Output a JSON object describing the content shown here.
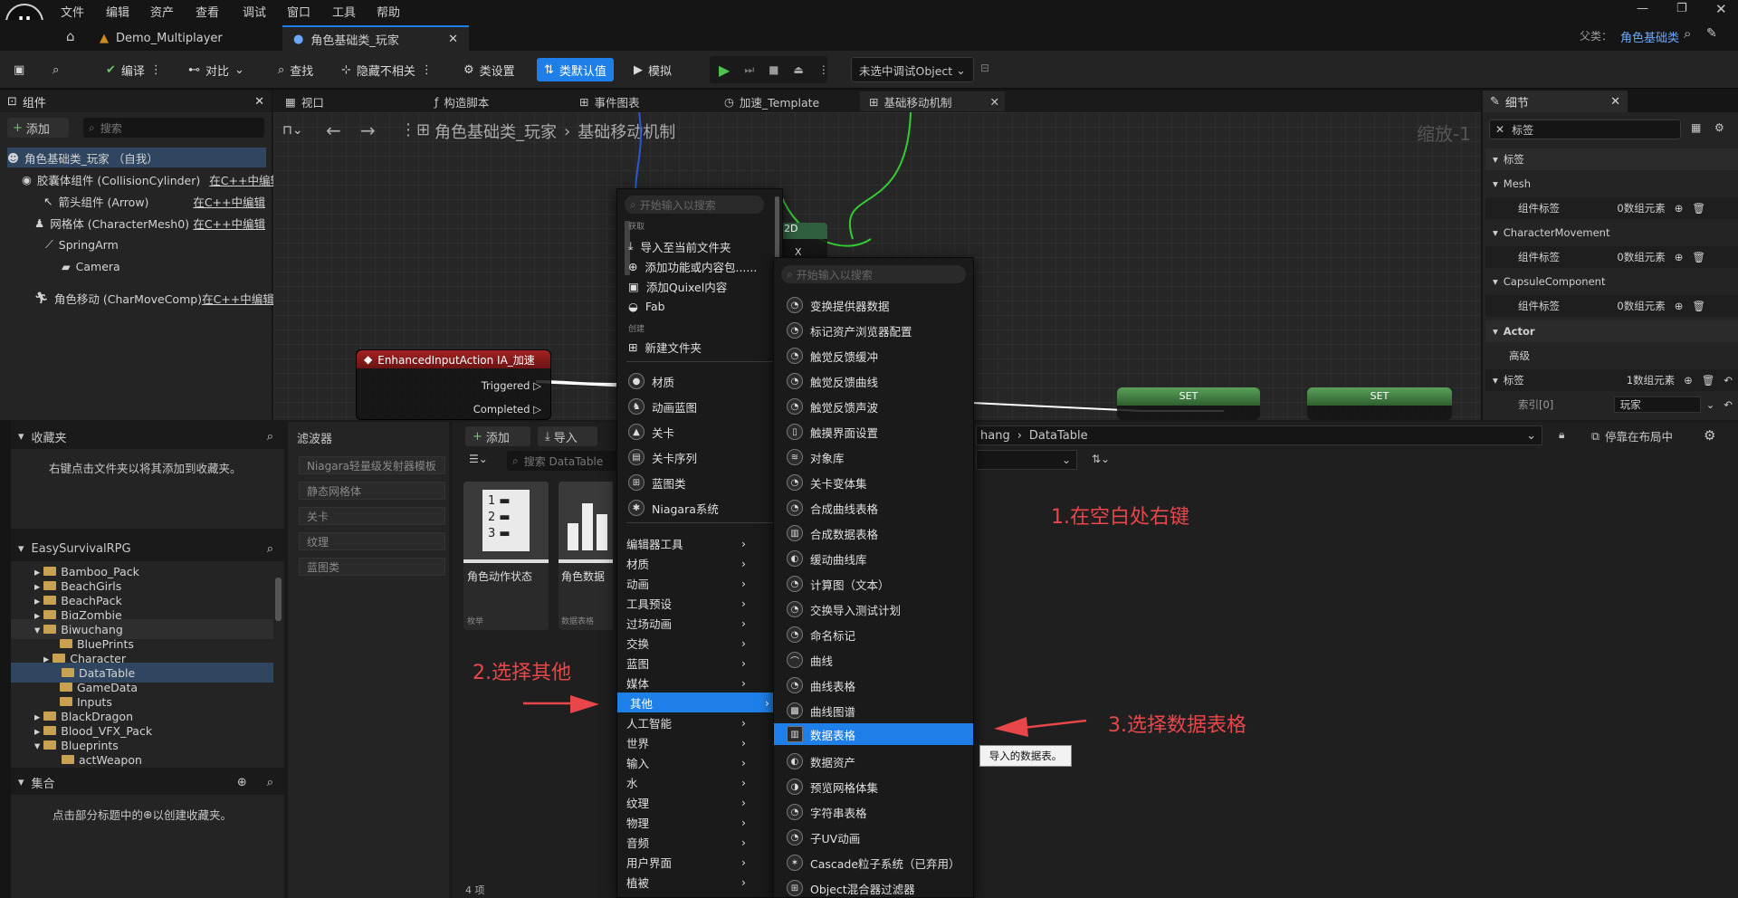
{
  "menubar": {
    "items": [
      "文件",
      "编辑",
      "资产",
      "查看",
      "调试",
      "窗口",
      "工具",
      "帮助"
    ]
  },
  "tabs": {
    "project": "Demo_Multiplayer",
    "active": "角色基础类_玩家"
  },
  "parent": {
    "label": "父类：",
    "value": "角色基础类"
  },
  "toolbar": {
    "compile": "编译",
    "diff": "对比",
    "find": "查找",
    "hide_unrelated": "隐藏不相关",
    "class_settings": "类设置",
    "class_defaults": "类默认值",
    "simulate": "模拟",
    "debug_object": "未选中调试Object"
  },
  "components": {
    "title": "组件",
    "add": "添加",
    "search_placeholder": "搜索",
    "root": "角色基础类_玩家 （自我）",
    "edit_cpp": "在C++中编辑",
    "items": [
      "胶囊体组件 (CollisionCylinder)",
      "箭头组件 (Arrow)",
      "网格体 (CharacterMesh0)",
      "SpringArm",
      "Camera",
      "角色移动 (CharMoveComp)"
    ]
  },
  "graph_tabs": [
    "视口",
    "构造脚本",
    "事件图表",
    "加速_Template",
    "基础移动机制"
  ],
  "breadcrumb": {
    "root": "角色基础类_玩家",
    "current": "基础移动机制",
    "zoom": "缩放-1"
  },
  "node": {
    "title": "EnhancedInputAction IA_加速",
    "pin1": "Triggered",
    "pin2": "Completed",
    "set": "SET",
    "node2d": "2D",
    "x": "X"
  },
  "details": {
    "title": "细节",
    "search_value": "标签",
    "sec_tags": "标签",
    "mesh": "Mesh",
    "comp_tags": "组件标签",
    "zero_elements": "0数组元素",
    "char_move": "CharacterMovement",
    "capsule": "CapsuleComponent",
    "actor": "Actor",
    "advanced": "高级",
    "tags": "标签",
    "one_element": "1数组元素",
    "index0": "索引[0]",
    "index_value": "玩家"
  },
  "content_browser": {
    "favorites": "收藏夹",
    "favorites_hint": "右键点击文件夹以将其添加到收藏夹。",
    "project": "EasySurvivalRPG",
    "filters": "滤波器",
    "add": "添加",
    "import": "导入",
    "search_placeholder": "搜索 DataTable",
    "path_tail": "hang",
    "path_folder": "DataTable",
    "dock": "停靠在布局中",
    "folders": [
      "Bamboo_Pack",
      "BeachGirls",
      "BeachPack",
      "BigZombie",
      "Biwuchang",
      "BluePrints",
      "Character",
      "DataTable",
      "GameData",
      "Inputs",
      "BlackDragon",
      "Blood_VFX_Pack",
      "Blueprints",
      "actWeapon"
    ],
    "filter_chips": [
      "Niagara轻量级发射器模板",
      "静态网格体",
      "关卡",
      "纹理",
      "蓝图类"
    ],
    "assets": [
      {
        "name": "角色动作状态",
        "type": "枚举"
      },
      {
        "name": "角色数据",
        "type": "数据表格"
      }
    ],
    "collections": "集合",
    "collections_hint": "点击部分标题中的",
    "collections_hint2": "以创建收藏夹。",
    "count": "4 项"
  },
  "context_menu": {
    "search_placeholder": "开始输入以搜索",
    "sec_get": "获取",
    "import_here": "导入至当前文件夹",
    "add_feature": "添加功能或内容包......",
    "add_quixel": "添加Quixel内容",
    "fab": "Fab",
    "sec_create": "创建",
    "new_folder": "新建文件夹",
    "basic": [
      "材质",
      "动画蓝图",
      "关卡",
      "关卡序列",
      "蓝图类",
      "Niagara系统"
    ],
    "categories": [
      "编辑器工具",
      "材质",
      "动画",
      "工具预设",
      "过场动画",
      "交换",
      "蓝图",
      "媒体",
      "其他",
      "人工智能",
      "世界",
      "输入",
      "水",
      "纹理",
      "物理",
      "音频",
      "用户界面",
      "植被"
    ]
  },
  "submenu": {
    "search_placeholder": "开始输入以搜索",
    "items": [
      "变换提供器数据",
      "标记资产浏览器配置",
      "触觉反馈缓冲",
      "触觉反馈曲线",
      "触觉反馈声波",
      "触摸界面设置",
      "对象库",
      "关卡变体集",
      "合成曲线表格",
      "合成数据表格",
      "缓动曲线库",
      "计算图（文本）",
      "交换导入测试计划",
      "命名标记",
      "曲线",
      "曲线表格",
      "曲线图谱",
      "数据表格",
      "数据资产",
      "预览网格体集",
      "字符串表格",
      "子UV动画",
      "Cascade粒子系统（已弃用）",
      "Object混合器过滤器"
    ],
    "tooltip": "导入的数据表。"
  },
  "annotations": {
    "step1": "1.在空白处右键",
    "step2": "2.选择其他",
    "step3": "3.选择数据表格"
  },
  "colors": {
    "accent": "#1f7fe8",
    "annot": "#e7474a",
    "node_red": "#8a1d1d",
    "node_green": "#3f7a3f"
  }
}
